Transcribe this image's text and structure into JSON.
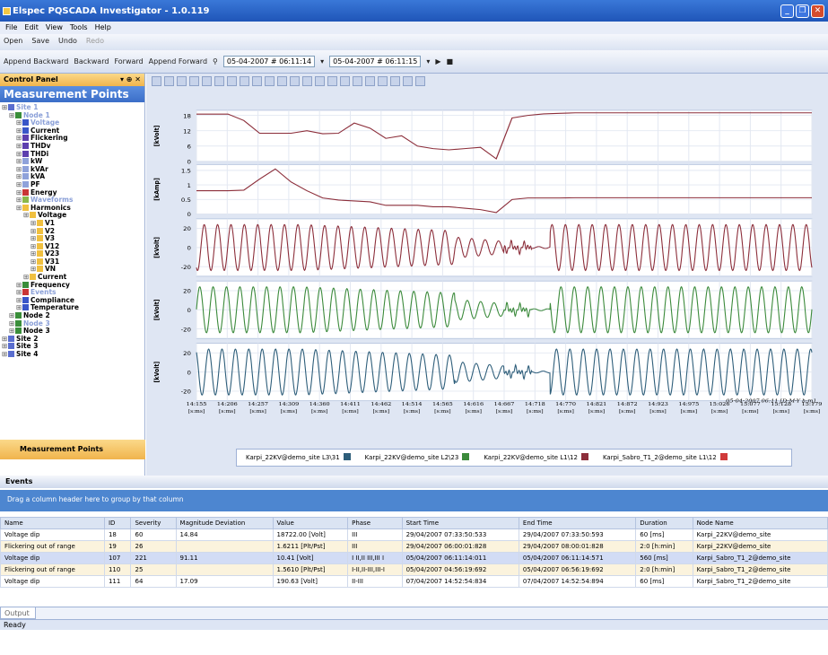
{
  "app": {
    "title": "Elspec PQSCADA Investigator - 1.0.119"
  },
  "menu": [
    "File",
    "Edit",
    "View",
    "Tools",
    "Help"
  ],
  "toolbar1": {
    "open": "Open",
    "save": "Save",
    "undo": "Undo",
    "redo": "Redo"
  },
  "toolbar2": {
    "append_backward": "Append Backward",
    "backward": "Backward",
    "forward": "Forward",
    "append_forward": "Append Forward",
    "start": "05-04-2007 # 06:11:14",
    "end": "05-04-2007 # 06:11:15"
  },
  "panel": {
    "header": "Control Panel",
    "title": "Measurement Points",
    "footer": "Measurement Points"
  },
  "tree": [
    {
      "label": "Site 1",
      "indent": 0,
      "color": "#5a6ecf",
      "grey": true
    },
    {
      "label": "Node 1",
      "indent": 1,
      "color": "#3a8e3a",
      "grey": true
    },
    {
      "label": "Voltage",
      "indent": 2,
      "color": "#3956c8",
      "grey": true
    },
    {
      "label": "Current",
      "indent": 2,
      "color": "#3956c8"
    },
    {
      "label": "Flickering",
      "indent": 2,
      "color": "#5c3fae"
    },
    {
      "label": "THDv",
      "indent": 2,
      "color": "#5c3fae"
    },
    {
      "label": "THDi",
      "indent": 2,
      "color": "#5c3fae"
    },
    {
      "label": "kW",
      "indent": 2,
      "color": "#8fa2da"
    },
    {
      "label": "kVAr",
      "indent": 2,
      "color": "#8fa2da"
    },
    {
      "label": "kVA",
      "indent": 2,
      "color": "#8fa2da"
    },
    {
      "label": "PF",
      "indent": 2,
      "color": "#8fa2da"
    },
    {
      "label": "Energy",
      "indent": 2,
      "color": "#c93636"
    },
    {
      "label": "Waveforms",
      "indent": 2,
      "color": "#8bb84a",
      "grey": true
    },
    {
      "label": "Harmonics",
      "indent": 2,
      "color": "#f0c040"
    },
    {
      "label": "Voltage",
      "indent": 3,
      "color": "#f0c040"
    },
    {
      "label": "V1",
      "indent": 4,
      "color": "#f0c040"
    },
    {
      "label": "V2",
      "indent": 4,
      "color": "#f0c040"
    },
    {
      "label": "V3",
      "indent": 4,
      "color": "#f0c040"
    },
    {
      "label": "V12",
      "indent": 4,
      "color": "#f0c040"
    },
    {
      "label": "V23",
      "indent": 4,
      "color": "#f0c040"
    },
    {
      "label": "V31",
      "indent": 4,
      "color": "#f0c040"
    },
    {
      "label": "VN",
      "indent": 4,
      "color": "#f0c040"
    },
    {
      "label": "Current",
      "indent": 3,
      "color": "#f0c040"
    },
    {
      "label": "Frequency",
      "indent": 2,
      "color": "#3a8e3a"
    },
    {
      "label": "Events",
      "indent": 2,
      "color": "#c93636",
      "grey": true
    },
    {
      "label": "Compliance",
      "indent": 2,
      "color": "#3956c8"
    },
    {
      "label": "Temperature",
      "indent": 2,
      "color": "#3956c8"
    },
    {
      "label": "Node 2",
      "indent": 1,
      "color": "#3a8e3a"
    },
    {
      "label": "Node 3",
      "indent": 1,
      "color": "#3a8e3a",
      "grey": true
    },
    {
      "label": "Node 3",
      "indent": 1,
      "color": "#3a8e3a"
    },
    {
      "label": "Site 2",
      "indent": 0,
      "color": "#5a6ecf"
    },
    {
      "label": "Site 3",
      "indent": 0,
      "color": "#5a6ecf"
    },
    {
      "label": "Site 4",
      "indent": 0,
      "color": "#5a6ecf"
    }
  ],
  "chart_data": {
    "type": "line",
    "x_ticks": [
      "14:155",
      "14:206",
      "14:257",
      "14:309",
      "14:360",
      "14:411",
      "14:462",
      "14:514",
      "14:565",
      "14:616",
      "14:667",
      "14:718",
      "14:770",
      "14:821",
      "14:872",
      "14:923",
      "14:975",
      "15:026",
      "15:077",
      "15:128",
      "15:179"
    ],
    "x_tick_unit": "[s:ms]",
    "x_footer": "05-04-2007 06:11 [D-M-Y h:m]",
    "panels": [
      {
        "ylabel": "[kVolt]",
        "ticks": [
          "18",
          "12",
          "6",
          "0"
        ],
        "ymin": 0,
        "ymax": 20,
        "color": "#8c2e3a",
        "kind": "rms",
        "values": [
          18.5,
          18.5,
          18.5,
          16,
          11,
          11,
          11,
          12,
          10.8,
          11,
          15,
          13,
          9,
          10,
          6,
          5,
          4.5,
          5,
          5.5,
          1,
          17,
          18,
          18.6,
          18.8,
          19,
          19,
          19,
          19,
          19,
          19,
          19,
          19,
          19,
          19,
          19,
          19,
          19,
          19,
          19,
          19
        ]
      },
      {
        "ylabel": "[kAmp]",
        "ticks": [
          "1.5",
          "1",
          "0.5",
          "0"
        ],
        "ymin": 0,
        "ymax": 1.7,
        "color": "#8c2e3a",
        "kind": "rms",
        "values": [
          0.8,
          0.8,
          0.8,
          0.82,
          1.2,
          1.55,
          1.1,
          0.8,
          0.55,
          0.48,
          0.45,
          0.42,
          0.3,
          0.3,
          0.3,
          0.25,
          0.25,
          0.2,
          0.15,
          0.05,
          0.5,
          0.55,
          0.55,
          0.55,
          0.56,
          0.56,
          0.56,
          0.56,
          0.56,
          0.56,
          0.56,
          0.56,
          0.56,
          0.56,
          0.56,
          0.56,
          0.56,
          0.56,
          0.56,
          0.56
        ]
      },
      {
        "ylabel": "[kVolt]",
        "ticks": [
          "20",
          "0",
          "-20"
        ],
        "ymin": -30,
        "ymax": 30,
        "color": "#8c2e3a",
        "kind": "wave"
      },
      {
        "ylabel": "[kVolt]",
        "ticks": [
          "20",
          "0",
          "-20"
        ],
        "ymin": -30,
        "ymax": 30,
        "color": "#3b8a3b",
        "kind": "wave"
      },
      {
        "ylabel": "[kVolt]",
        "ticks": [
          "20",
          "0",
          "-20"
        ],
        "ymin": -30,
        "ymax": 30,
        "color": "#2e5e7a",
        "kind": "wave"
      }
    ],
    "legend": [
      {
        "label": "Karpi_22KV@demo_site L3\\31",
        "color": "#2e5e7a"
      },
      {
        "label": "Karpi_22KV@demo_site L2\\23",
        "color": "#3b8a3b"
      },
      {
        "label": "Karpi_22KV@demo_site L1\\12",
        "color": "#8c2e3a"
      },
      {
        "label": "Karpi_Sabro_T1_2@demo_site L1\\12",
        "color": "#d03a3a"
      }
    ]
  },
  "events": {
    "title": "Events",
    "group_hint": "Drag a column header here to group by that column",
    "columns": [
      "Name",
      "ID",
      "Severity",
      "Magnitude Deviation",
      "Value",
      "Phase",
      "Start Time",
      "End Time",
      "Duration",
      "Node Name"
    ],
    "rows": [
      [
        "Voltage dip",
        "18",
        "60",
        "14.84",
        "18722.00 [Volt]",
        "III",
        "29/04/2007 07:33:50:533",
        "29/04/2007 07:33:50:593",
        "60 [ms]",
        "Karpi_22KV@demo_site"
      ],
      [
        "Flickering out of range",
        "19",
        "26",
        "",
        "1.6211 [Plt/Pst]",
        "III",
        "29/04/2007 06:00:01:828",
        "29/04/2007 08:00:01:828",
        "2:0 [h:min]",
        "Karpi_22KV@demo_site"
      ],
      [
        "Voltage dip",
        "107",
        "221",
        "91.11",
        "10.41 [Volt]",
        "I II,II III,III I",
        "05/04/2007 06:11:14:011",
        "05/04/2007 06:11:14:571",
        "560 [ms]",
        "Karpi_Sabro_T1_2@demo_site"
      ],
      [
        "Flickering out of range",
        "110",
        "25",
        "",
        "1.5610 [Plt/Pst]",
        "I-II,II-III,III-I",
        "05/04/2007 04:56:19:692",
        "05/04/2007 06:56:19:692",
        "2:0 [h:min]",
        "Karpi_Sabro_T1_2@demo_site"
      ],
      [
        "Voltage dip",
        "111",
        "64",
        "17.09",
        "190.63 [Volt]",
        "II-III",
        "07/04/2007 14:52:54:834",
        "07/04/2007 14:52:54:894",
        "60 [ms]",
        "Karpi_Sabro_T1_2@demo_site"
      ]
    ]
  },
  "output_tab": "Output",
  "status": "Ready"
}
